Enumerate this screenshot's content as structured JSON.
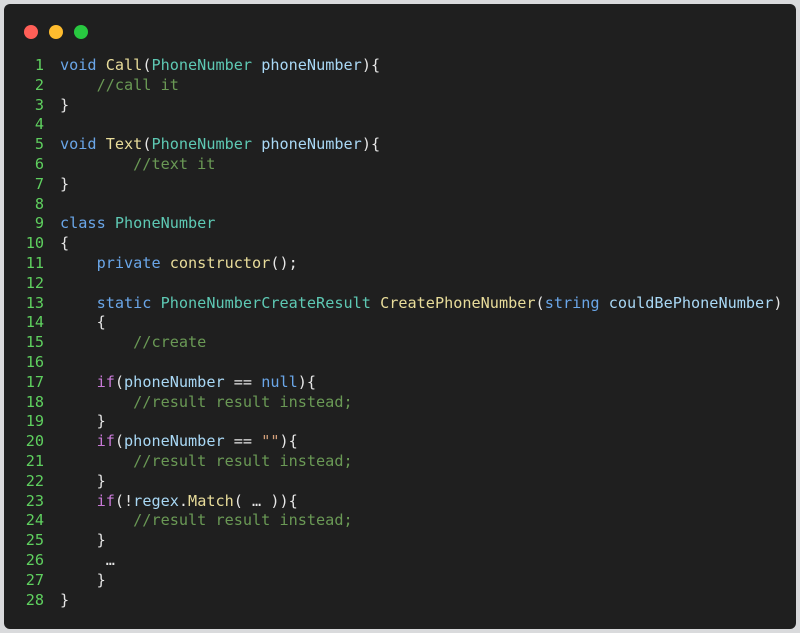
{
  "window": {
    "controls": {
      "close_color": "#ff5f57",
      "minimize_color": "#febc2e",
      "maximize_color": "#28c840"
    }
  },
  "editor": {
    "theme": {
      "background": "#1f1f1f",
      "line_number_color": "#5fd05f"
    },
    "lines": [
      {
        "n": "1",
        "tokens": [
          [
            "kw",
            "void"
          ],
          [
            "pu",
            " "
          ],
          [
            "fn",
            "Call"
          ],
          [
            "pu",
            "("
          ],
          [
            "ty",
            "PhoneNumber"
          ],
          [
            "pu",
            " "
          ],
          [
            "va",
            "phoneNumber"
          ],
          [
            "pu",
            "){"
          ]
        ]
      },
      {
        "n": "2",
        "tokens": [
          [
            "pu",
            "    "
          ],
          [
            "cm",
            "//call it"
          ]
        ]
      },
      {
        "n": "3",
        "tokens": [
          [
            "pu",
            "}"
          ]
        ]
      },
      {
        "n": "4",
        "tokens": []
      },
      {
        "n": "5",
        "tokens": [
          [
            "kw",
            "void"
          ],
          [
            "pu",
            " "
          ],
          [
            "fn",
            "Text"
          ],
          [
            "pu",
            "("
          ],
          [
            "ty",
            "PhoneNumber"
          ],
          [
            "pu",
            " "
          ],
          [
            "va",
            "phoneNumber"
          ],
          [
            "pu",
            "){"
          ]
        ]
      },
      {
        "n": "6",
        "tokens": [
          [
            "pu",
            "        "
          ],
          [
            "cm",
            "//text it"
          ]
        ]
      },
      {
        "n": "7",
        "tokens": [
          [
            "pu",
            "}"
          ]
        ]
      },
      {
        "n": "8",
        "tokens": []
      },
      {
        "n": "9",
        "tokens": [
          [
            "kw",
            "class"
          ],
          [
            "pu",
            " "
          ],
          [
            "ty",
            "PhoneNumber"
          ]
        ]
      },
      {
        "n": "10",
        "tokens": [
          [
            "pu",
            "{"
          ]
        ]
      },
      {
        "n": "11",
        "tokens": [
          [
            "pu",
            "    "
          ],
          [
            "kw",
            "private"
          ],
          [
            "pu",
            " "
          ],
          [
            "fn",
            "constructor"
          ],
          [
            "pu",
            "();"
          ]
        ]
      },
      {
        "n": "12",
        "tokens": []
      },
      {
        "n": "13",
        "tokens": [
          [
            "pu",
            "    "
          ],
          [
            "kw",
            "static"
          ],
          [
            "pu",
            " "
          ],
          [
            "ty",
            "PhoneNumberCreateResult"
          ],
          [
            "pu",
            " "
          ],
          [
            "fn",
            "CreatePhoneNumber"
          ],
          [
            "pu",
            "("
          ],
          [
            "kw",
            "string"
          ],
          [
            "pu",
            " "
          ],
          [
            "va",
            "couldBePhoneNumber"
          ],
          [
            "pu",
            ")"
          ]
        ]
      },
      {
        "n": "14",
        "tokens": [
          [
            "pu",
            "    {"
          ]
        ]
      },
      {
        "n": "15",
        "tokens": [
          [
            "pu",
            "        "
          ],
          [
            "cm",
            "//create"
          ]
        ]
      },
      {
        "n": "16",
        "tokens": []
      },
      {
        "n": "17",
        "tokens": [
          [
            "pu",
            "    "
          ],
          [
            "ct",
            "if"
          ],
          [
            "pu",
            "("
          ],
          [
            "va",
            "phoneNumber"
          ],
          [
            "pu",
            " == "
          ],
          [
            "nl",
            "null"
          ],
          [
            "pu",
            "){"
          ]
        ]
      },
      {
        "n": "18",
        "tokens": [
          [
            "pu",
            "        "
          ],
          [
            "cm",
            "//result result instead;"
          ]
        ]
      },
      {
        "n": "19",
        "tokens": [
          [
            "pu",
            "    }"
          ]
        ]
      },
      {
        "n": "20",
        "tokens": [
          [
            "pu",
            "    "
          ],
          [
            "ct",
            "if"
          ],
          [
            "pu",
            "("
          ],
          [
            "va",
            "phoneNumber"
          ],
          [
            "pu",
            " == "
          ],
          [
            "st",
            "\"\""
          ],
          [
            "pu",
            "){"
          ]
        ]
      },
      {
        "n": "21",
        "tokens": [
          [
            "pu",
            "        "
          ],
          [
            "cm",
            "//result result instead;"
          ]
        ]
      },
      {
        "n": "22",
        "tokens": [
          [
            "pu",
            "    }"
          ]
        ]
      },
      {
        "n": "23",
        "tokens": [
          [
            "pu",
            "    "
          ],
          [
            "ct",
            "if"
          ],
          [
            "pu",
            "(!"
          ],
          [
            "va",
            "regex"
          ],
          [
            "pu",
            "."
          ],
          [
            "fn",
            "Match"
          ],
          [
            "pu",
            "( … )){"
          ]
        ]
      },
      {
        "n": "24",
        "tokens": [
          [
            "pu",
            "        "
          ],
          [
            "cm",
            "//result result instead;"
          ]
        ]
      },
      {
        "n": "25",
        "tokens": [
          [
            "pu",
            "    }"
          ]
        ]
      },
      {
        "n": "26",
        "tokens": [
          [
            "pu",
            "     …"
          ]
        ]
      },
      {
        "n": "27",
        "tokens": [
          [
            "pu",
            "    }"
          ]
        ]
      },
      {
        "n": "28",
        "tokens": [
          [
            "pu",
            "}"
          ]
        ]
      }
    ]
  }
}
